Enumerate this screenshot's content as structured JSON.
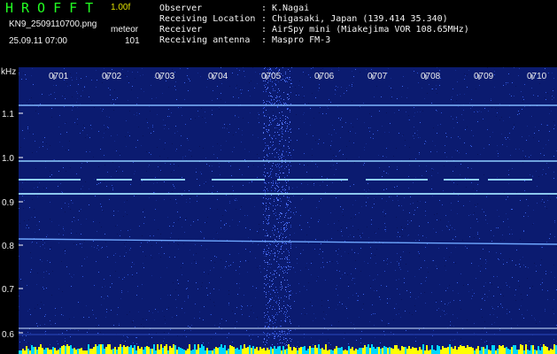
{
  "header": {
    "logo": "HROFFT",
    "version": "1.00f",
    "filename": "KN9_2509110700.png",
    "datetime": "25.09.11 07:00",
    "mode": "meteor",
    "count": "101"
  },
  "info": [
    {
      "key": "Observer",
      "value": "K.Nagai"
    },
    {
      "key": "Receiving Location",
      "value": "Chigasaki, Japan (139.414 35.340)"
    },
    {
      "key": "Receiver",
      "value": "AirSpy mini (Miakejima VOR 108.65MHz)"
    },
    {
      "key": "Receiving antenna",
      "value": "Maspro FM-3"
    }
  ],
  "axis": {
    "y_unit": "kHz",
    "y_ticks": [
      "1.1",
      "1.0",
      "0.9",
      "0.8",
      "0.7",
      "0.6"
    ],
    "x_ticks": [
      "0701",
      "0702",
      "0703",
      "0704",
      "0705",
      "0706",
      "0707",
      "0708",
      "0709",
      "0710"
    ]
  },
  "colors": {
    "background": "#000000",
    "spectrum_base": "#0a1a6e",
    "logo": "#22ff22",
    "version": "#e0e000",
    "signal_line": "#8fd0ff",
    "bottom_bar": "#ffff00"
  }
}
